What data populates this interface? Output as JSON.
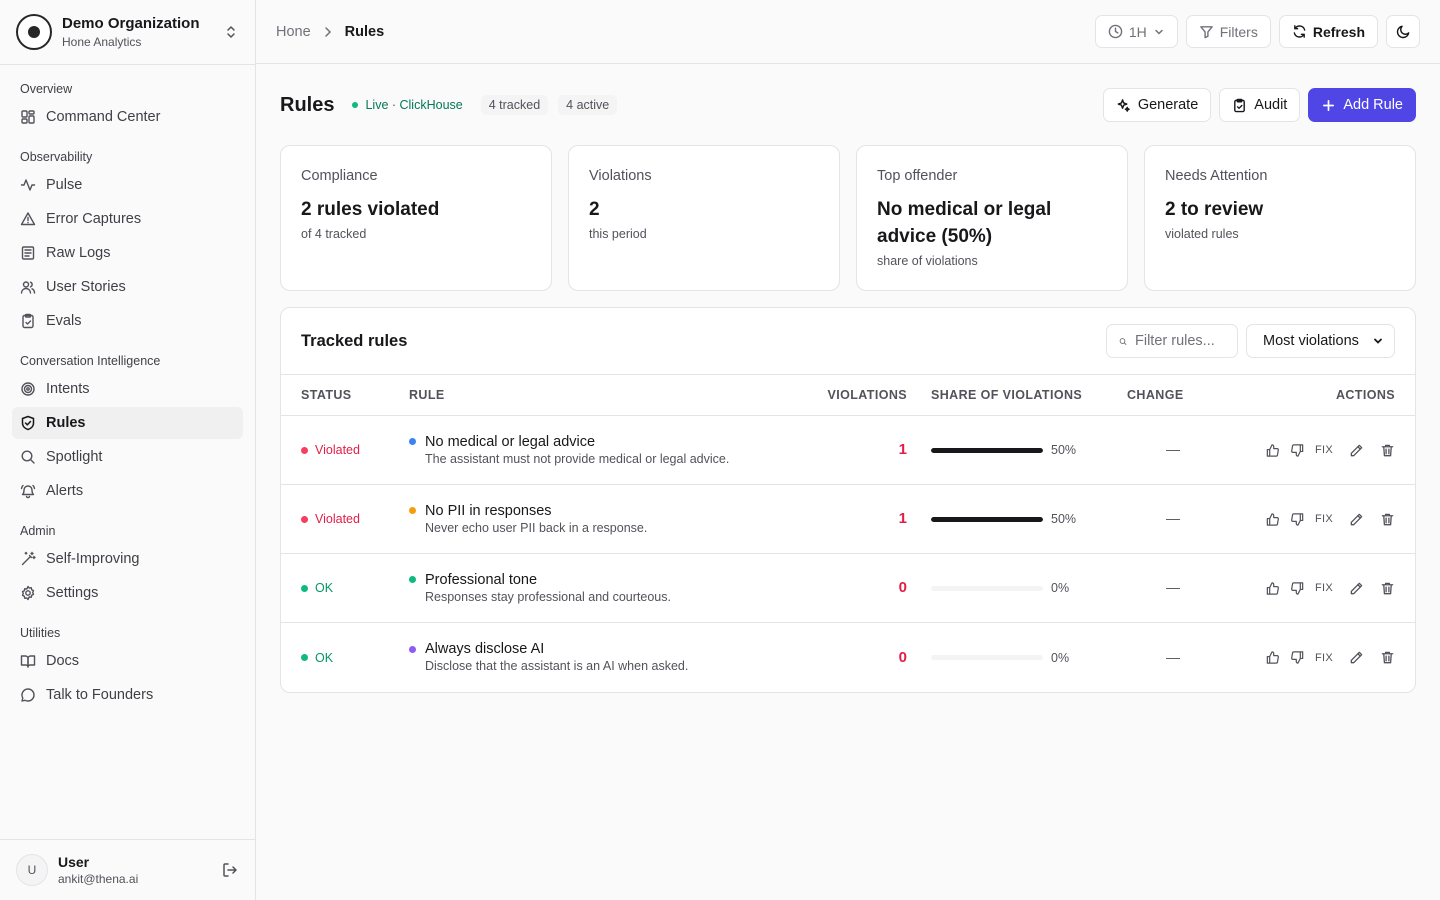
{
  "org": {
    "name": "Demo Organization",
    "subtitle": "Hone Analytics"
  },
  "sidebar": {
    "sections": [
      {
        "title": "Overview",
        "items": [
          {
            "label": "Command Center",
            "icon": "grid-icon"
          }
        ]
      },
      {
        "title": "Observability",
        "items": [
          {
            "label": "Pulse",
            "icon": "activity-icon"
          },
          {
            "label": "Error Captures",
            "icon": "warning-icon"
          },
          {
            "label": "Raw Logs",
            "icon": "logs-icon"
          },
          {
            "label": "User Stories",
            "icon": "users-icon"
          },
          {
            "label": "Evals",
            "icon": "clipboard-check-icon"
          }
        ]
      },
      {
        "title": "Conversation Intelligence",
        "items": [
          {
            "label": "Intents",
            "icon": "target-icon"
          },
          {
            "label": "Rules",
            "icon": "shield-check-icon",
            "active": true
          },
          {
            "label": "Spotlight",
            "icon": "search-icon"
          },
          {
            "label": "Alerts",
            "icon": "bell-icon"
          }
        ]
      },
      {
        "title": "Admin",
        "items": [
          {
            "label": "Self-Improving",
            "icon": "magic-wand-icon"
          },
          {
            "label": "Settings",
            "icon": "gear-icon"
          }
        ]
      },
      {
        "title": "Utilities",
        "items": [
          {
            "label": "Docs",
            "icon": "book-icon"
          },
          {
            "label": "Talk to Founders",
            "icon": "chat-icon"
          }
        ]
      }
    ]
  },
  "user": {
    "initial": "U",
    "name": "User",
    "email": "ankit@thena.ai"
  },
  "topbar": {
    "breadcrumb": {
      "home": "Hone",
      "current": "Rules"
    },
    "time_range": "1H",
    "filters_label": "Filters",
    "refresh_label": "Refresh"
  },
  "page": {
    "title": "Rules",
    "live_label": "Live · ClickHouse",
    "tracked_pill": "4 tracked",
    "active_pill": "4 active",
    "generate_label": "Generate",
    "audit_label": "Audit",
    "add_label": "Add Rule"
  },
  "cards": [
    {
      "label": "Compliance",
      "value": "2 rules violated",
      "sub": "of 4 tracked"
    },
    {
      "label": "Violations",
      "value": "2",
      "sub": "this period"
    },
    {
      "label": "Top offender",
      "value": "No medical or legal advice (50%)",
      "sub": "share of violations"
    },
    {
      "label": "Needs Attention",
      "value": "2 to review",
      "sub": "violated rules"
    }
  ],
  "table": {
    "title": "Tracked rules",
    "search_placeholder": "Filter rules...",
    "sort_value": "Most violations",
    "headers": {
      "status": "STATUS",
      "rule": "RULE",
      "violations": "VIOLATIONS",
      "share": "SHARE OF VIOLATIONS",
      "change": "CHANGE",
      "actions": "ACTIONS"
    },
    "fix_label": "FIX",
    "rows": [
      {
        "status": "Violated",
        "status_color": "#e11d48",
        "status_dot": "#f43f5e",
        "dot_color": "#3b82f6",
        "title": "No medical or legal advice",
        "desc": "The assistant must not provide medical or legal advice.",
        "violations": "1",
        "share": 1.0,
        "share_label": "50%",
        "change": "—"
      },
      {
        "status": "Violated",
        "status_color": "#e11d48",
        "status_dot": "#f43f5e",
        "dot_color": "#f59e0b",
        "title": "No PII in responses",
        "desc": "Never echo user PII back in a response.",
        "violations": "1",
        "share": 1.0,
        "share_label": "50%",
        "change": "—"
      },
      {
        "status": "OK",
        "status_color": "#059669",
        "status_dot": "#10b981",
        "dot_color": "#10b981",
        "title": "Professional tone",
        "desc": "Responses stay professional and courteous.",
        "violations": "0",
        "share": 0,
        "share_label": "0%",
        "change": "—"
      },
      {
        "status": "OK",
        "status_color": "#059669",
        "status_dot": "#10b981",
        "dot_color": "#8b5cf6",
        "title": "Always disclose AI",
        "desc": "Disclose that the assistant is an AI when asked.",
        "violations": "0",
        "share": 0,
        "share_label": "0%",
        "change": "—"
      }
    ]
  }
}
